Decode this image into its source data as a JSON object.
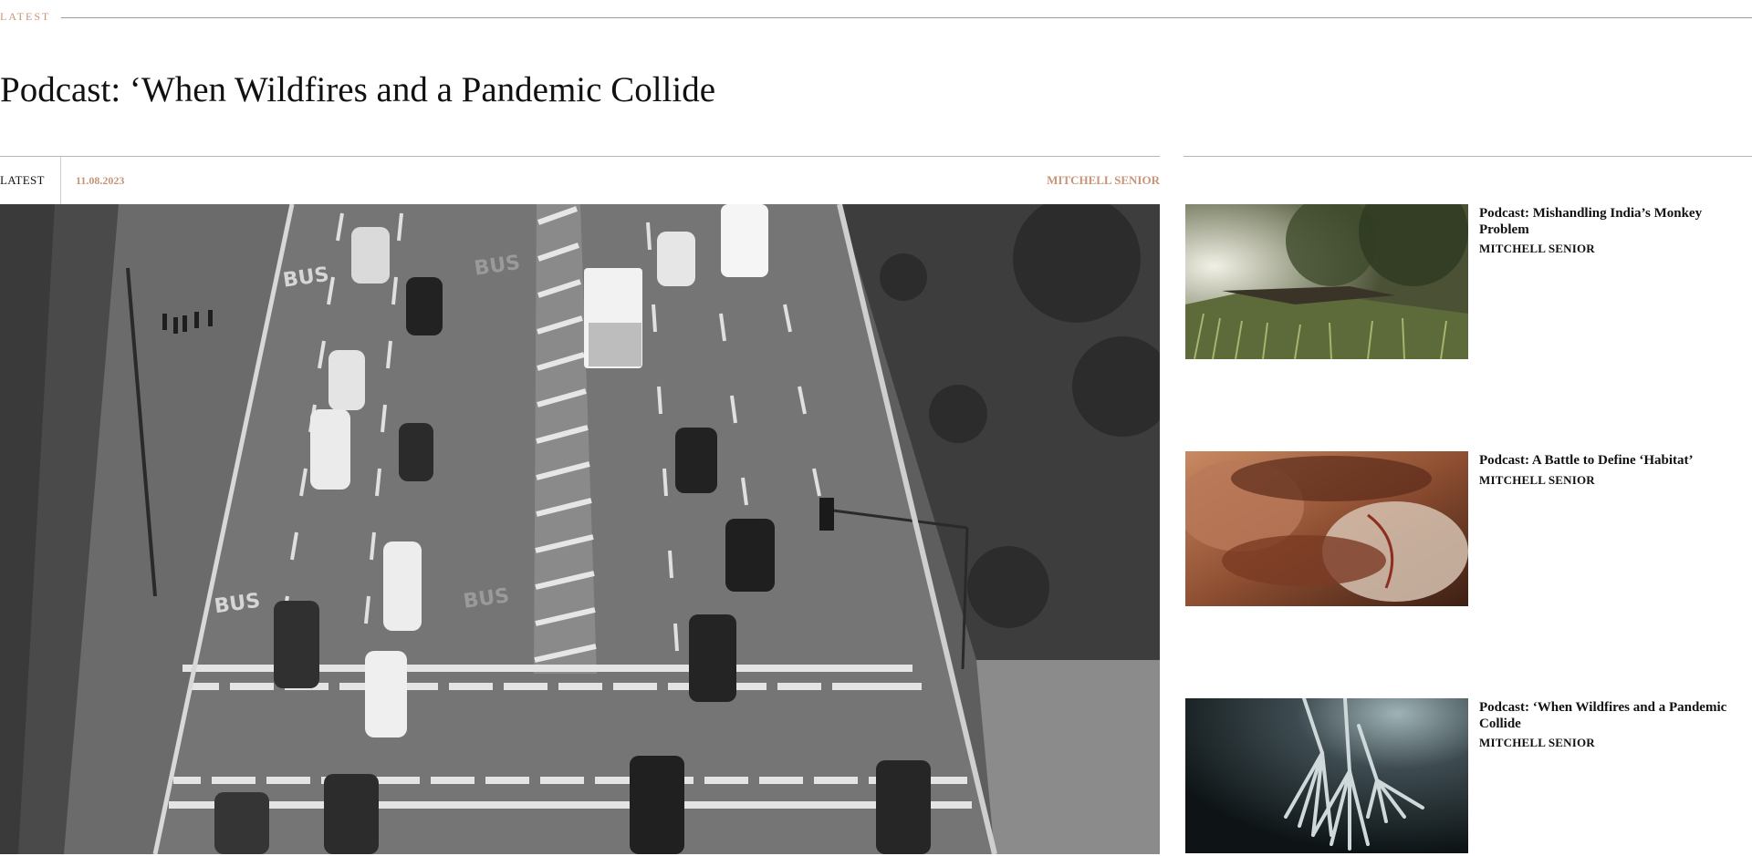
{
  "section": {
    "label": "LATEST"
  },
  "article": {
    "title": "Podcast: ‘When Wildfires and a Pandemic Collide",
    "category": "LATEST",
    "date": "11.08.2023",
    "author": "MITCHELL SENIOR"
  },
  "sidebar": {
    "items": [
      {
        "title": "Podcast: Mishandling India’s Monkey Problem",
        "author": "MITCHELL SENIOR"
      },
      {
        "title": "Podcast: A Battle to Define ‘Habitat’",
        "author": "MITCHELL SENIOR"
      },
      {
        "title": "Podcast: ‘When Wildfires and a Pandemic Collide",
        "author": "MITCHELL SENIOR"
      }
    ]
  },
  "colors": {
    "accent": "#c79478",
    "text": "#111111",
    "rule": "#9a9a9a"
  }
}
